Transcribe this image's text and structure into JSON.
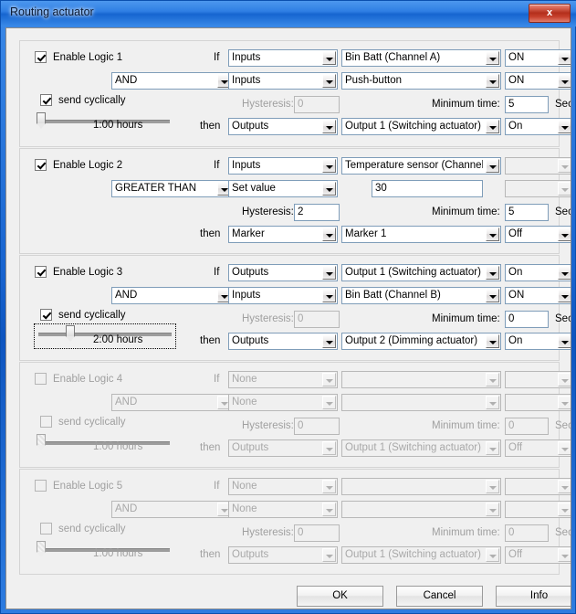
{
  "window": {
    "title": "Routing actuator",
    "close_label": "x"
  },
  "labels": {
    "if": "If",
    "then": "then",
    "hysteresis": "Hysteresis:",
    "minimum_time": "Minimum time:",
    "sec": "Sec.",
    "send_cyclically": "send cyclically"
  },
  "blocks": [
    {
      "enable_label": "Enable Logic 1",
      "enabled": true,
      "operator": "AND",
      "send_cyclically": true,
      "cycle_time": "1:00 hours",
      "slider_percent": 0,
      "slider_focused": false,
      "row1": {
        "source": "Inputs",
        "object": "Bin Batt (Channel A)",
        "state": "ON"
      },
      "row2": {
        "source": "Inputs",
        "object": "Push-button",
        "state": "ON"
      },
      "hysteresis": "0",
      "hysteresis_enabled": false,
      "minimum_time": "5",
      "minimum_time_enabled": true,
      "action": {
        "source": "Outputs",
        "object": "Output 1 (Switching actuator)",
        "state": "On"
      }
    },
    {
      "enable_label": "Enable Logic 2",
      "enabled": true,
      "operator": "GREATER THAN",
      "send_cyclically": false,
      "show_cyclic": false,
      "cycle_time": "",
      "slider_percent": 0,
      "slider_focused": false,
      "row1": {
        "source": "Inputs",
        "object": "Temperature sensor (Channel.",
        "state": ""
      },
      "row2": {
        "source": "Set value",
        "object": "30",
        "state": ""
      },
      "hysteresis": "2",
      "hysteresis_enabled": true,
      "minimum_time": "5",
      "minimum_time_enabled": true,
      "action": {
        "source": "Marker",
        "object": "Marker 1",
        "state": "Off"
      }
    },
    {
      "enable_label": "Enable Logic 3",
      "enabled": true,
      "operator": "AND",
      "send_cyclically": true,
      "cycle_time": "2:00 hours",
      "slider_percent": 25,
      "slider_focused": true,
      "row1": {
        "source": "Outputs",
        "object": "Output 1 (Switching actuator)",
        "state": "On"
      },
      "row2": {
        "source": "Inputs",
        "object": "Bin Batt (Channel B)",
        "state": "ON"
      },
      "hysteresis": "0",
      "hysteresis_enabled": false,
      "minimum_time": "0",
      "minimum_time_enabled": true,
      "action": {
        "source": "Outputs",
        "object": "Output 2 (Dimming actuator)",
        "state": "On"
      }
    },
    {
      "enable_label": "Enable Logic 4",
      "enabled": false,
      "operator": "AND",
      "send_cyclically": false,
      "cycle_time": "1:00 hours",
      "slider_percent": 0,
      "slider_focused": false,
      "row1": {
        "source": "None",
        "object": "",
        "state": ""
      },
      "row2": {
        "source": "None",
        "object": "",
        "state": ""
      },
      "hysteresis": "0",
      "hysteresis_enabled": false,
      "minimum_time": "0",
      "minimum_time_enabled": false,
      "action": {
        "source": "Outputs",
        "object": "Output 1 (Switching actuator)",
        "state": "Off"
      }
    },
    {
      "enable_label": "Enable Logic 5",
      "enabled": false,
      "operator": "AND",
      "send_cyclically": false,
      "cycle_time": "1:00 hours",
      "slider_percent": 0,
      "slider_focused": false,
      "row1": {
        "source": "None",
        "object": "",
        "state": ""
      },
      "row2": {
        "source": "None",
        "object": "",
        "state": ""
      },
      "hysteresis": "0",
      "hysteresis_enabled": false,
      "minimum_time": "0",
      "minimum_time_enabled": false,
      "action": {
        "source": "Outputs",
        "object": "Output 1 (Switching actuator)",
        "state": "Off"
      }
    }
  ],
  "buttons": {
    "ok": "OK",
    "cancel": "Cancel",
    "info": "Info"
  }
}
